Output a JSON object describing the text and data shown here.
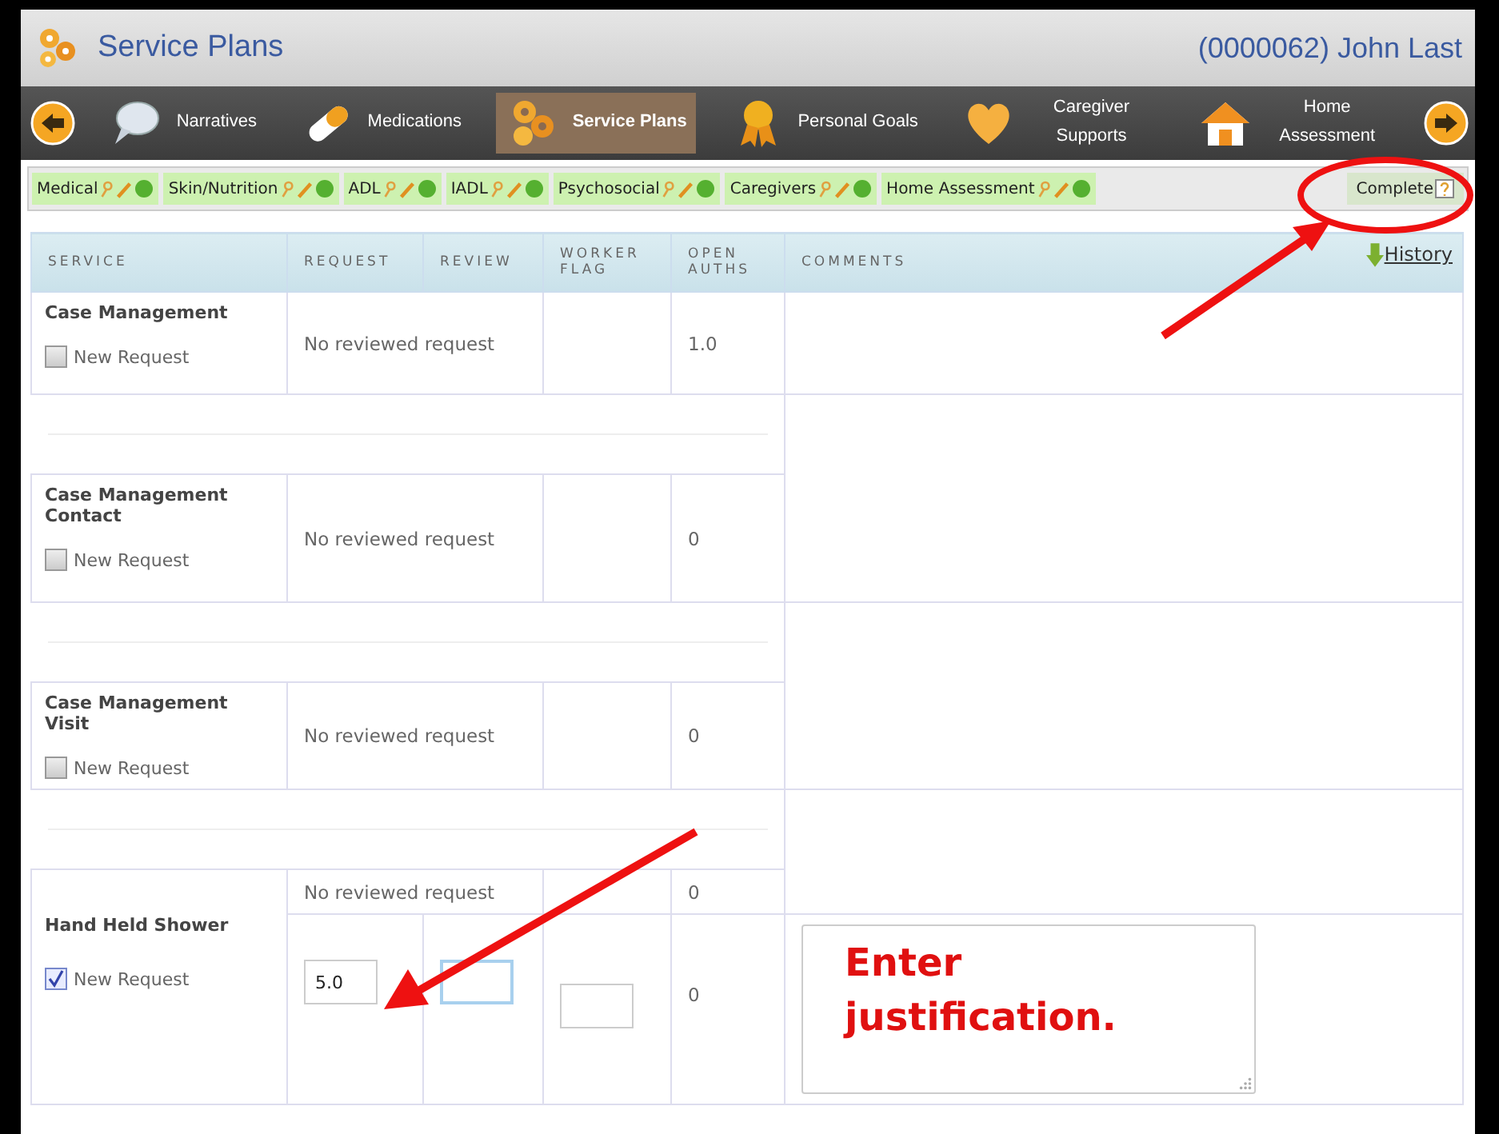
{
  "header": {
    "title": "Service Plans",
    "client": "(0000062) John Last"
  },
  "nav": [
    {
      "kind": "back"
    },
    {
      "kind": "narratives",
      "label": "Narratives",
      "selected": false
    },
    {
      "kind": "medications",
      "label": "Medications",
      "selected": false
    },
    {
      "kind": "plans",
      "label": "Service Plans",
      "selected": true
    },
    {
      "kind": "goals",
      "label": "Personal Goals",
      "selected": false
    },
    {
      "kind": "caregiver",
      "label": "Caregiver Supports",
      "selected": false
    },
    {
      "kind": "home",
      "label": "Home Assessment",
      "selected": false
    },
    {
      "kind": "forward"
    }
  ],
  "sections": [
    {
      "kind": "section",
      "label": "Medical",
      "selected": false
    },
    {
      "kind": "section",
      "label": "Skin/Nutrition",
      "selected": false
    },
    {
      "kind": "section",
      "label": "ADL",
      "selected": false
    },
    {
      "kind": "section",
      "label": "IADL",
      "selected": false
    },
    {
      "kind": "section",
      "label": "Psychosocial",
      "selected": false
    },
    {
      "kind": "section",
      "label": "Caregivers",
      "selected": false
    },
    {
      "kind": "section",
      "label": "Home Assessment",
      "selected": false
    },
    {
      "kind": "complete",
      "label": "Complete",
      "selected": true
    }
  ],
  "table": {
    "columns": [
      "SERVICE",
      "REQUEST",
      "REVIEW",
      "WORKER FLAG",
      "OPEN AUTHS",
      "COMMENTS"
    ],
    "history_link": "History",
    "rows": [
      {
        "kind": "plain",
        "service": "Case Management",
        "new_request": "New Request",
        "checked": false,
        "reviewed": "No reviewed request",
        "open_auths": "1.0"
      },
      {
        "kind": "plain",
        "service": "Case Management Contact",
        "new_request": "New Request",
        "checked": false,
        "reviewed": "No reviewed request",
        "open_auths": "0"
      },
      {
        "kind": "plain",
        "service": "Case Management Visit",
        "new_request": "New Request",
        "checked": false,
        "reviewed": "No reviewed request",
        "open_auths": "0"
      },
      {
        "kind": "entry",
        "service": "Hand Held Shower",
        "new_request": "New Request",
        "checked": true,
        "reviewed": "No reviewed request",
        "open_auths": "0",
        "request_value": "5.0",
        "new_open_auths": "0"
      }
    ]
  },
  "annotations": {
    "callout": "Enter justification."
  }
}
